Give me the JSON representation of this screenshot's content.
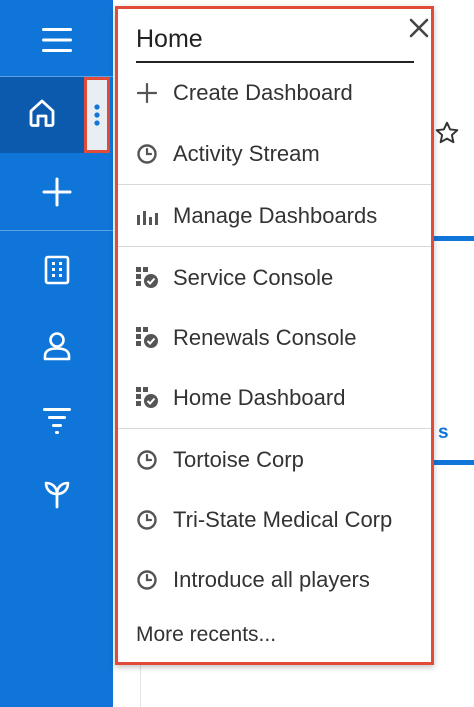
{
  "nav": {
    "items": [
      {
        "name": "menu-icon"
      },
      {
        "name": "home-icon"
      },
      {
        "name": "plus-icon"
      },
      {
        "name": "building-icon"
      },
      {
        "name": "person-icon"
      },
      {
        "name": "filter-icon"
      },
      {
        "name": "sprout-icon"
      }
    ]
  },
  "dropdown": {
    "title": "Home",
    "close_icon": "close-icon",
    "items": [
      {
        "icon": "plus-icon",
        "label": "Create Dashboard"
      },
      {
        "icon": "clock-icon",
        "label": "Activity Stream"
      },
      {
        "icon": "bar-chart-icon",
        "label": "Manage Dashboards"
      },
      {
        "icon": "dashboard-icon",
        "label": "Service Console"
      },
      {
        "icon": "dashboard-icon",
        "label": "Renewals Console"
      },
      {
        "icon": "dashboard-icon",
        "label": "Home Dashboard"
      },
      {
        "icon": "clock-icon",
        "label": "Tortoise Corp"
      },
      {
        "icon": "clock-icon",
        "label": "Tri-State Medical Corp"
      },
      {
        "icon": "clock-icon",
        "label": "Introduce all players"
      }
    ],
    "more": "More recents..."
  },
  "background": {
    "tab_fragment": "s"
  },
  "colors": {
    "rail": "#0f75d8",
    "rail_active": "#0b5aad",
    "highlight": "#e04b3a"
  }
}
